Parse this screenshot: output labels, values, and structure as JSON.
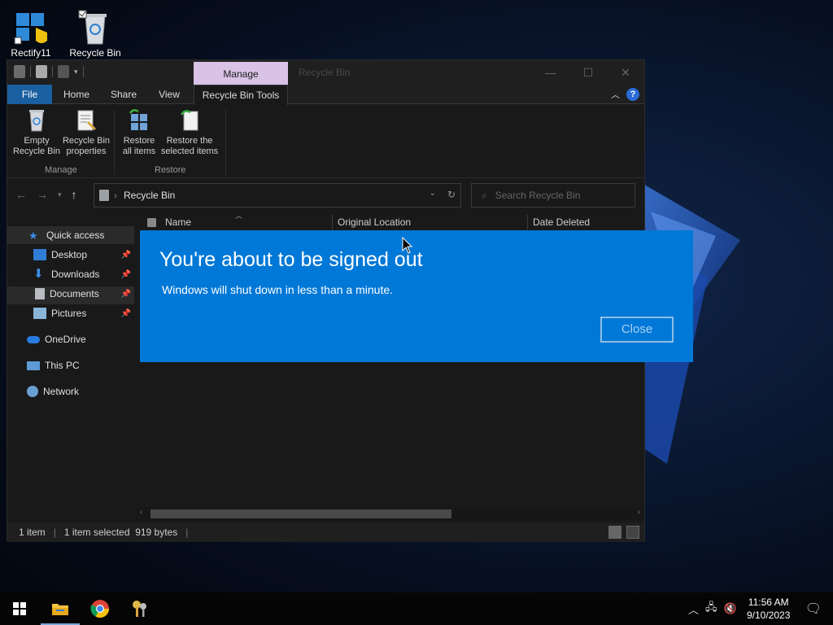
{
  "desktop": {
    "icons": [
      {
        "label": "Rectify11"
      },
      {
        "label": "Recycle Bin"
      }
    ]
  },
  "explorer": {
    "title": "Recycle Bin",
    "manage_tab": "Manage",
    "tabs": {
      "file": "File",
      "home": "Home",
      "share": "Share",
      "view": "View",
      "tools": "Recycle Bin Tools"
    },
    "ribbon": {
      "empty_line1": "Empty",
      "empty_line2": "Recycle Bin",
      "props_line1": "Recycle Bin",
      "props_line2": "properties",
      "restore_all_line1": "Restore",
      "restore_all_line2": "all items",
      "restore_sel_line1": "Restore the",
      "restore_sel_line2": "selected items",
      "group_manage": "Manage",
      "group_restore": "Restore"
    },
    "address": {
      "crumb": "Recycle Bin",
      "search_placeholder": "Search Recycle Bin"
    },
    "nav": {
      "quick_access": "Quick access",
      "desktop": "Desktop",
      "downloads": "Downloads",
      "documents": "Documents",
      "pictures": "Pictures",
      "onedrive": "OneDrive",
      "this_pc": "This PC",
      "network": "Network"
    },
    "columns": {
      "name": "Name",
      "original_location": "Original Location",
      "date_deleted": "Date Deleted"
    },
    "status": {
      "count": "1 item",
      "selection": "1 item selected  919 bytes"
    }
  },
  "dialog": {
    "title": "You're about to be signed out",
    "message": "Windows will shut down in less than a minute.",
    "close_label": "Close"
  },
  "taskbar": {
    "time": "11:56 AM",
    "date": "9/10/2023"
  },
  "colors": {
    "dialog_bg": "#0078d7",
    "file_tab": "#1a5fa0",
    "manage_tab": "#d8c2e5"
  }
}
